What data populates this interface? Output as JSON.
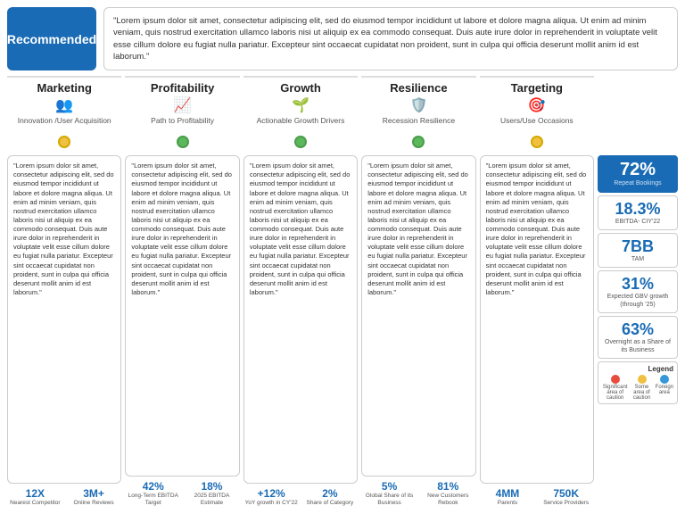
{
  "recommended": {
    "label": "Recommended"
  },
  "quote": {
    "text": "\"Lorem ipsum dolor sit amet, consectetur adipiscing elit, sed do eiusmod tempor incididunt ut labore et dolore magna aliqua. Ut enim ad minim veniam, quis nostrud exercitation ullamco laboris nisi ut aliquip ex ea commodo consequat. Duis aute irure dolor in reprehenderit in voluptate velit esse cillum dolore eu fugiat nulla pariatur. Excepteur sint occaecat cupidatat non proident, sunt in culpa qui officia deserunt mollit anim id est laborum.\""
  },
  "columns": [
    {
      "title": "Marketing",
      "icon": "👥",
      "subtitle": "Innovation /User Acquisition",
      "dot_color": "yellow",
      "body_text": "\"Lorem ipsum dolor sit amet, consectetur adipiscing elit, sed do eiusmod tempor incididunt ut labore et dolore magna aliqua. Ut enim ad minim veniam, quis nostrud exercitation ullamco laboris nisi ut aliquip ex ea commodo consequat. Duis aute irure dolor in reprehenderit in voluptate velit esse cillum dolore eu fugiat nulla pariatur. Excepteur sint occaecat cupidatat non proident, sunt in culpa qui officia deserunt mollit anim id est laborum.\"",
      "metrics": [
        {
          "value": "12X",
          "label": "Nearest Competitor"
        },
        {
          "value": "3M+",
          "label": "Online Reviews"
        }
      ]
    },
    {
      "title": "Profitability",
      "icon": "📈",
      "subtitle": "Path to Profitability",
      "dot_color": "green",
      "body_text": "\"Lorem ipsum dolor sit amet, consectetur adipiscing elit, sed do eiusmod tempor incididunt ut labore et dolore magna aliqua. Ut enim ad minim veniam, quis nostrud exercitation ullamco laboris nisi ut aliquip ex ea commodo consequat. Duis aute irure dolor in reprehenderit in voluptate velit esse cillum dolore eu fugiat nulla pariatur. Excepteur sint occaecat cupidatat non proident, sunt in culpa qui officia deserunt mollit anim id est laborum.\"",
      "metrics": [
        {
          "value": "42%",
          "label": "Long-Term EBITDA Target"
        },
        {
          "value": "18%",
          "label": "2025 EBITDA Estimate"
        }
      ]
    },
    {
      "title": "Growth",
      "icon": "🌱",
      "subtitle": "Actionable Growth Drivers",
      "dot_color": "green",
      "body_text": "\"Lorem ipsum dolor sit amet, consectetur adipiscing elit, sed do eiusmod tempor incididunt ut labore et dolore magna aliqua. Ut enim ad minim veniam, quis nostrud exercitation ullamco laboris nisi ut aliquip ex ea commodo consequat. Duis aute irure dolor in reprehenderit in voluptate velit esse cillum dolore eu fugiat nulla pariatur. Excepteur sint occaecat cupidatat non proident, sunt in culpa qui officia deserunt mollit anim id est laborum.\"",
      "metrics": [
        {
          "value": "+12%",
          "label": "YoY growth in CY'22"
        },
        {
          "value": "2%",
          "label": "Share of Category"
        }
      ]
    },
    {
      "title": "Resilience",
      "icon": "🛡️",
      "subtitle": "Recession Resilience",
      "dot_color": "green",
      "body_text": "\"Lorem ipsum dolor sit amet, consectetur adipiscing elit, sed do eiusmod tempor incididunt ut labore et dolore magna aliqua. Ut enim ad minim veniam, quis nostrud exercitation ullamco laboris nisi ut aliquip ex ea commodo consequat. Duis aute irure dolor in reprehenderit in voluptate velit esse cillum dolore eu fugiat nulla pariatur. Excepteur sint occaecat cupidatat non proident, sunt in culpa qui officia deserunt mollit anim id est laborum.\"",
      "metrics": [
        {
          "value": "5%",
          "label": "Global Share of its Business"
        },
        {
          "value": "81%",
          "label": "New Customers Rebook"
        }
      ]
    },
    {
      "title": "Targeting",
      "icon": "🎯",
      "subtitle": "Users/Use Occasions",
      "dot_color": "yellow",
      "body_text": "\"Lorem ipsum dolor sit amet, consectetur adipiscing elit, sed do eiusmod tempor incididunt ut labore et dolore magna aliqua. Ut enim ad minim veniam, quis nostrud exercitation ullamco laboris nisi ut aliquip ex ea commodo consequat. Duis aute irure dolor in reprehenderit in voluptate velit esse cillum dolore eu fugiat nulla pariatur. Excepteur sint occaecat cupidatat non proident, sunt in culpa qui officia deserunt mollit anim id est laborum.\"",
      "metrics": [
        {
          "value": "4MM",
          "label": "Parents"
        },
        {
          "value": "750K",
          "label": "Service Providers"
        }
      ]
    }
  ],
  "stats": [
    {
      "value": "72%",
      "label": "Repeat Bookings",
      "style": "blue"
    },
    {
      "value": "18.3%",
      "label": "EBITDA- CIY'22",
      "style": "normal"
    },
    {
      "value": "7BB",
      "label": "TAM",
      "style": "normal"
    },
    {
      "value": "31%",
      "label": "Expected GBV growth (through '25)",
      "style": "normal"
    },
    {
      "value": "63%",
      "label": "Overnight as a Share of its Business",
      "style": "normal"
    }
  ],
  "legend": {
    "title": "Legend",
    "items": [
      {
        "color": "#e74c3c",
        "label": "Significant area of caution"
      },
      {
        "color": "#f0c040",
        "label": "Some area of caution"
      },
      {
        "color": "#3498db",
        "label": "Foreign area"
      }
    ]
  }
}
